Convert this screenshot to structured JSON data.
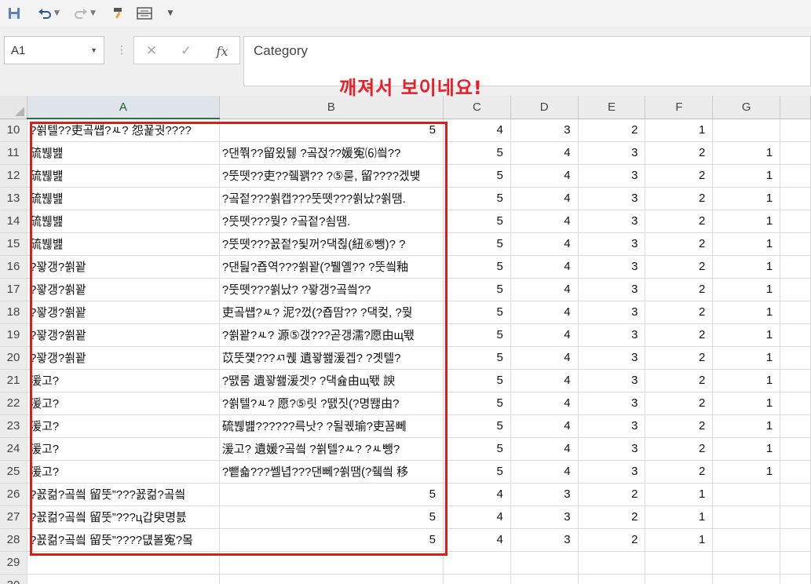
{
  "quick_access": {
    "save_icon": "save-icon",
    "undo_icon": "undo-icon",
    "redo_icon": "redo-icon",
    "format_painter_icon": "format-painter-icon",
    "wrap_icon": "wrap-text-icon",
    "customize_icon": "customize-dropdown-icon"
  },
  "formula_bar": {
    "name_box": "A1",
    "cancel_icon": "✕",
    "enter_icon": "✓",
    "fx_label": "fx",
    "content": "Category"
  },
  "annotation": {
    "text": "깨져서 보이네요!",
    "color": "#ee1c24"
  },
  "sheet": {
    "columns": [
      "A",
      "B",
      "C",
      "D",
      "E",
      "F",
      "G"
    ],
    "selected_column": "A",
    "rows": [
      {
        "num": "10",
        "a": "?쐵텔??吏곸썝?ㅻ? 怨꾩궛????",
        "b": "5",
        "c": "4",
        "d": "3",
        "e": "2",
        "f": "1",
        "g": ""
      },
      {
        "num": "11",
        "a": "硫붾뱶",
        "b": "?댄쭦??留욌뒗 ?곸젅??媛寃⑹씤??",
        "c": "5",
        "d": "4",
        "e": "3",
        "f": "2",
        "g": "1"
      },
      {
        "num": "12",
        "a": "硫붾뱶",
        "b": "?뚯뗏??吏??쥌꽭?? ?⑤룯, 留????겠뱾",
        "c": "5",
        "d": "4",
        "e": "3",
        "f": "2",
        "g": "1"
      },
      {
        "num": "13",
        "a": "硫붾뱶",
        "b": "?곸젙???쐵캡???뚯뗏???쐵났?쐵땜.",
        "c": "5",
        "d": "4",
        "e": "3",
        "f": "2",
        "g": "1"
      },
      {
        "num": "14",
        "a": "硫붾뱶",
        "b": "?뚯뗏???뭦? ?곸젙?쇰땜.",
        "c": "5",
        "d": "4",
        "e": "3",
        "f": "2",
        "g": "1"
      },
      {
        "num": "15",
        "a": "硫붾뱶",
        "b": "?뚯뗏???꾨젙?됯꺼?댁쥖(紐⑥뺑)? ?",
        "c": "5",
        "d": "4",
        "e": "3",
        "f": "2",
        "g": "1"
      },
      {
        "num": "16",
        "a": "?꽣갱?쐵꽡",
        "b": "?댄딆?죱역???쐵꽡(?뷀옐?? ?뚯씤釉",
        "c": "5",
        "d": "4",
        "e": "3",
        "f": "2",
        "g": "1"
      },
      {
        "num": "17",
        "a": "?꽣갱?쐵꽡",
        "b": "?뚯뗏???쐵났? ?꽣갱?곸씤??",
        "c": "5",
        "d": "4",
        "e": "3",
        "f": "2",
        "g": "1"
      },
      {
        "num": "18",
        "a": "?꽣갱?쐵꽡",
        "b": "吏곸썝?ㅻ? 泥?껐(?죱땀?? ?댁컻, ?뭦",
        "c": "5",
        "d": "4",
        "e": "3",
        "f": "2",
        "g": "1"
      },
      {
        "num": "19",
        "a": "?꽣갱?쐵꽡",
        "b": "?쐵꽡?ㅻ? 源⑤갡???곧갱濡?愿由щ뙋",
        "c": "5",
        "d": "4",
        "e": "3",
        "f": "2",
        "g": "1"
      },
      {
        "num": "20",
        "a": "?꽣갱?쐵꽡",
        "b": "苡뚯쟻???ㅺ퀝 遺꽣쐞湲겝? ?곗텔?",
        "c": "5",
        "d": "4",
        "e": "3",
        "f": "2",
        "g": "1"
      },
      {
        "num": "21",
        "a": "湲고?",
        "b": "?땘룸 遺꽣쐞湲겟? ?댁슖由щ뙋 諛",
        "c": "5",
        "d": "4",
        "e": "3",
        "f": "2",
        "g": "1"
      },
      {
        "num": "22",
        "a": "湲고?",
        "b": "?쐵텔?ㅻ? 愿?⑤릿 ?땘짓(?명뙎由? ",
        "c": "5",
        "d": "4",
        "e": "3",
        "f": "2",
        "g": "1"
      },
      {
        "num": "23",
        "a": "湲고?",
        "b": "硫붾뱶??????륵낫? ?될궧瑜?吏꾬뻬",
        "c": "5",
        "d": "4",
        "e": "3",
        "f": "2",
        "g": "1"
      },
      {
        "num": "24",
        "a": "湲고?",
        "b": "湲고? 遺媛?곸씤 ?쐵텔?ㅻ? ?ㅻ뺑?",
        "c": "5",
        "d": "4",
        "e": "3",
        "f": "2",
        "g": "1"
      },
      {
        "num": "25",
        "a": "湲고?",
        "b": "?뺕숇???쎌녑???댄뻬?쐵땜(?쥌씤 移",
        "c": "5",
        "d": "4",
        "e": "3",
        "f": "2",
        "g": "1"
      },
      {
        "num": "26",
        "a": "?꾨컮?곸씤 留뚯”???꾨컮?곸씤",
        "b": "5",
        "c": "4",
        "d": "3",
        "e": "2",
        "f": "1",
        "g": ""
      },
      {
        "num": "27",
        "a": "?꾨컮?곸씤 留뚯”???ц갑臾명븘",
        "b": "5",
        "c": "4",
        "d": "3",
        "e": "2",
        "f": "1",
        "g": ""
      },
      {
        "num": "28",
        "a": "?꾨컮?곸씤 留뚯”????덊볼寃?뫀",
        "b": "5",
        "c": "4",
        "d": "3",
        "e": "2",
        "f": "1",
        "g": ""
      },
      {
        "num": "29",
        "a": "",
        "b": "",
        "c": "",
        "d": "",
        "e": "",
        "f": "",
        "g": ""
      },
      {
        "num": "30",
        "a": "",
        "b": "",
        "c": "",
        "d": "",
        "e": "",
        "f": "",
        "g": ""
      }
    ]
  }
}
